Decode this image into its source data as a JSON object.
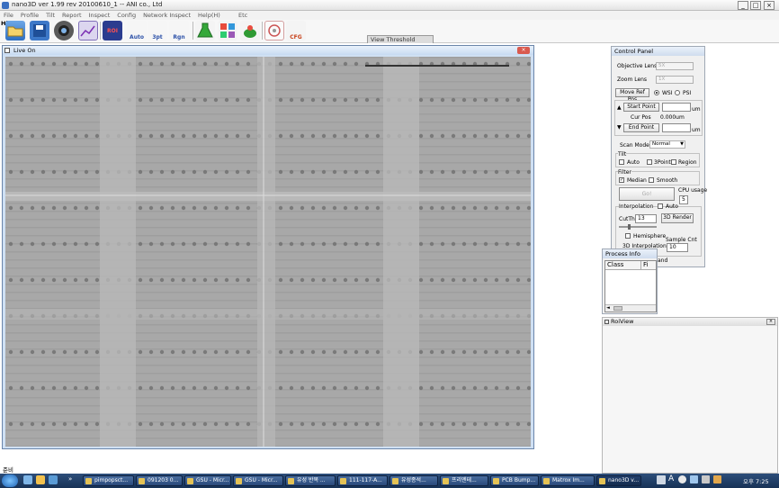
{
  "window": {
    "title": "nano3D ver 1.99 rev 20100610_1 -- ANI co., Ltd"
  },
  "menu": {
    "items": [
      "File",
      "Profile",
      "Tilt",
      "Report",
      "Inspect",
      "Config",
      "Network Inspect",
      "Help(H)"
    ],
    "etc": "Etc"
  },
  "toolbar": {
    "hi": "Hi",
    "buttons": [
      {
        "name": "open-button",
        "icon": "folder-icon",
        "label": ""
      },
      {
        "name": "save-button",
        "icon": "floppy-icon",
        "label": ""
      },
      {
        "name": "camera-button",
        "icon": "camera-icon",
        "label": ""
      },
      {
        "name": "graph-button",
        "icon": "graph-icon",
        "label": ""
      },
      {
        "name": "roi-button",
        "icon": "roi-icon",
        "label": "ROI"
      },
      {
        "name": "auto-button",
        "icon": "auto-icon",
        "label": "Auto"
      },
      {
        "name": "3pt-button",
        "icon": "3pt-icon",
        "label": "3pt"
      },
      {
        "name": "rgn-button",
        "icon": "rgn-icon",
        "label": "Rgn"
      },
      {
        "name": "flask-button",
        "icon": "flask-icon",
        "label": ""
      },
      {
        "name": "grid-button",
        "icon": "grid-icon",
        "label": ""
      },
      {
        "name": "plant-button",
        "icon": "plant-icon",
        "label": ""
      },
      {
        "name": "scope-button",
        "icon": "scope-icon",
        "label": ""
      },
      {
        "name": "cfg-button",
        "icon": "cfg-icon",
        "label": "CFG"
      }
    ],
    "view_threshold_tab": "View Threshold"
  },
  "live": {
    "title": "Live On"
  },
  "control_panel": {
    "title": "Control Panel",
    "objective_lens_label": "Objective Lens",
    "objective_lens_value": "5X",
    "zoom_lens_label": "Zoom Lens",
    "zoom_lens_value": "1X",
    "move_ref_pos": "Move Ref Pos",
    "wsi": "WSI",
    "psi": "PSI",
    "start_point": "Start Point",
    "start_unit": "um",
    "cur_pos_label": "Cur Pos",
    "cur_pos_value": "0.000um",
    "end_point": "End Point",
    "end_unit": "um",
    "scan_mode_label": "Scan Mode",
    "scan_mode_value": "Normal",
    "tilt_label": "Tilt",
    "tilt_auto": "Auto",
    "tilt_3point": "3Point",
    "tilt_region": "Region",
    "filter_label": "Filter",
    "median": "Median",
    "smooth": "Smooth",
    "go_button": "Go!",
    "cpu_usage_label": "CPU usage",
    "cpu_usage_value": "5",
    "interpolation_label": "Interpolation",
    "interp_auto": "Auto",
    "cutth_label": "CutTh",
    "cutth_value": "13",
    "render_3d": "3D Render",
    "hemisphere": "Hemisphere",
    "interpolation_3d": "3D Interpolation",
    "sample_cnt_label": "Sample Cnt",
    "sample_cnt_value": "10",
    "band": "and"
  },
  "process_info": {
    "title": "Process Info",
    "columns": [
      "Class",
      "Fi"
    ]
  },
  "roi_view": {
    "title": "RoiView"
  },
  "status": {
    "text": "준비"
  },
  "taskbar": {
    "tasks": [
      "pimpopsct...",
      "091203 0...",
      "GSU - Micr...",
      "GSU - Micr...",
      "유성 반복 ...",
      "111-117-A...",
      "유성종석...",
      "프리엔테...",
      "PCB Bump...",
      "Matrox Im...",
      "nano3D v..."
    ],
    "tray_text": "A",
    "clock": "오후 7:25"
  }
}
